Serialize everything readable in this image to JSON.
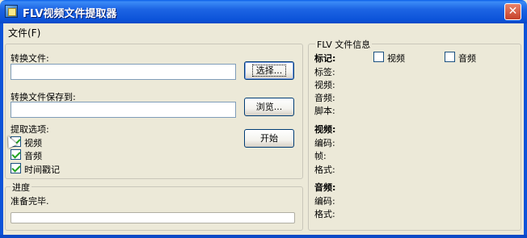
{
  "window": {
    "title": "FLV视频文件提取器",
    "close_glyph": "✕"
  },
  "menu": {
    "file": "文件(F)"
  },
  "input": {
    "convert_file_label": "转换文件:",
    "convert_file_value": "",
    "select_button": "选择...",
    "save_to_label": "转换文件保存到:",
    "save_to_value": "",
    "browse_button": "浏览...",
    "options_label": "提取选项:",
    "options": [
      {
        "label": "视频",
        "checked": true
      },
      {
        "label": "音频",
        "checked": true
      },
      {
        "label": "时间戳记",
        "checked": true
      }
    ],
    "start_button": "开始"
  },
  "progress": {
    "group_label": "进度",
    "status": "准备完毕.",
    "value": 0
  },
  "flv_info": {
    "group_label": "FLV 文件信息",
    "tags_label": "标记:",
    "tag_video_label": "视频",
    "tag_video_checked": false,
    "tag_audio_label": "音频",
    "tag_audio_checked": false,
    "tag_rows": [
      "标签:",
      "视频:",
      "音频:",
      "脚本:"
    ],
    "video_section": "视频:",
    "video_rows": [
      "编码:",
      "帧:",
      "格式:"
    ],
    "audio_section": "音频:",
    "audio_rows": [
      "编码:",
      "格式:"
    ]
  },
  "icons": {
    "app": "app-icon",
    "close": "close-icon",
    "cursor": "mouse-cursor-icon"
  }
}
